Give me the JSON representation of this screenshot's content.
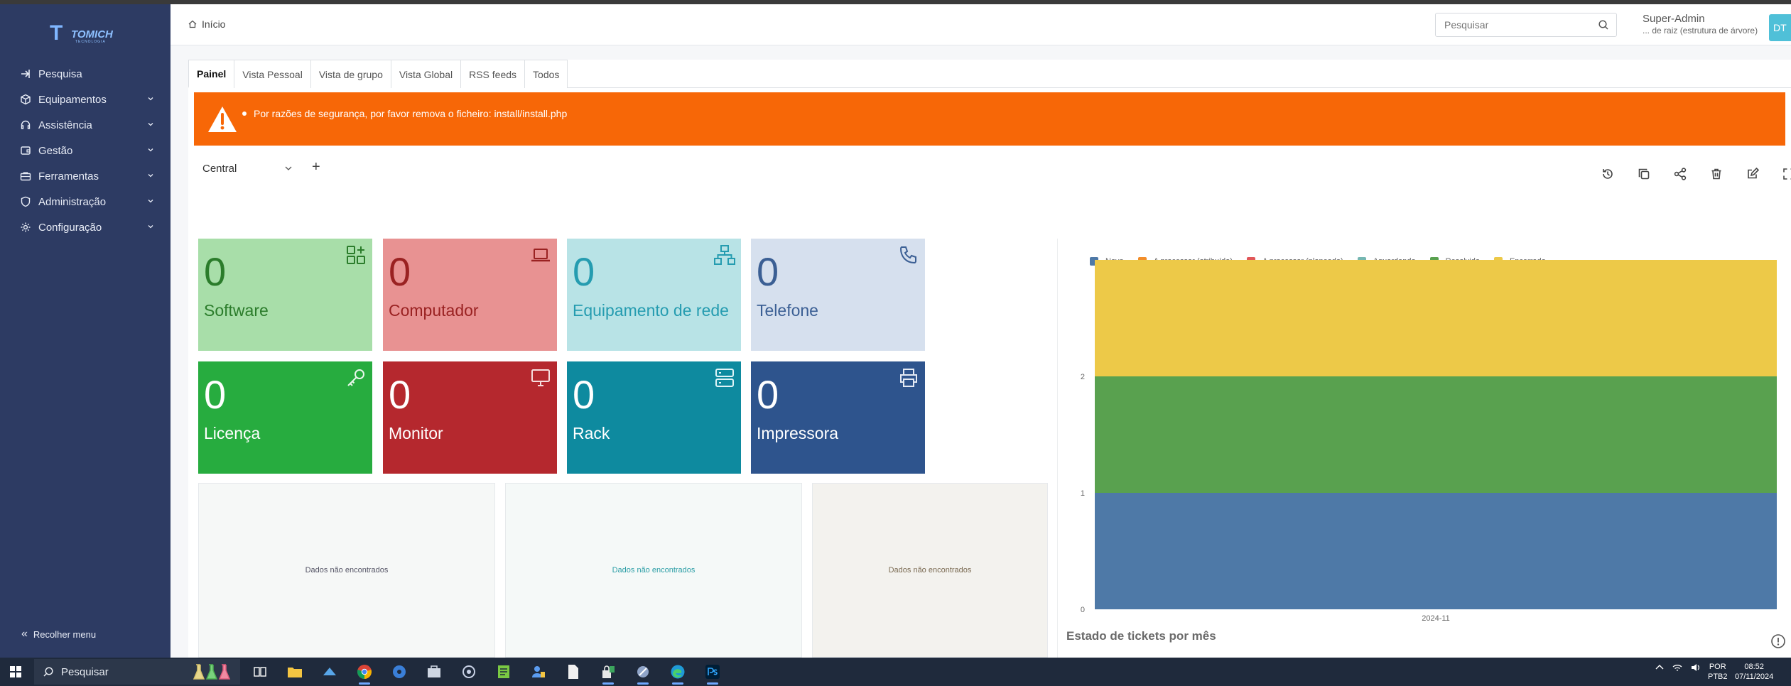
{
  "sidebar": {
    "logo": {
      "mark": "T",
      "brand": "TOMICH",
      "sub": "TECNOLOGIA"
    },
    "items": [
      {
        "label": "Pesquisa",
        "icon": "search-arrow-icon",
        "has_children": false
      },
      {
        "label": "Equipamentos",
        "icon": "cube-icon",
        "has_children": true
      },
      {
        "label": "Assistência",
        "icon": "headset-icon",
        "has_children": true
      },
      {
        "label": "Gestão",
        "icon": "wallet-icon",
        "has_children": true
      },
      {
        "label": "Ferramentas",
        "icon": "briefcase-icon",
        "has_children": true
      },
      {
        "label": "Administração",
        "icon": "shield-icon",
        "has_children": true
      },
      {
        "label": "Configuração",
        "icon": "gear-icon",
        "has_children": true
      }
    ],
    "collapse_label": "Recolher menu"
  },
  "header": {
    "breadcrumb": "Início",
    "search_placeholder": "Pesquisar",
    "user_name": "Super-Admin",
    "user_entity": "... de raiz (estrutura de árvore)",
    "avatar_initials": "DT"
  },
  "tabs": [
    "Painel",
    "Vista Pessoal",
    "Vista de grupo",
    "Vista Global",
    "RSS feeds",
    "Todos"
  ],
  "alert": {
    "message": "Por razões de segurança, por favor remova o ficheiro: install/install.php"
  },
  "dashboard": {
    "selected": "Central",
    "add_symbol": "+"
  },
  "cards": {
    "software": {
      "value": "0",
      "label": "Software"
    },
    "computer": {
      "value": "0",
      "label": "Computador"
    },
    "network": {
      "value": "0",
      "label": "Equipamento de rede"
    },
    "phone": {
      "value": "0",
      "label": "Telefone"
    },
    "license": {
      "value": "0",
      "label": "Licença"
    },
    "monitor": {
      "value": "0",
      "label": "Monitor"
    },
    "rack": {
      "value": "0",
      "label": "Rack"
    },
    "printer": {
      "value": "0",
      "label": "Impressora"
    }
  },
  "empty_widgets": [
    "Dados não encontrados",
    "Dados não encontrados",
    "Dados não encontrados"
  ],
  "chart_title": "Estado de tickets por mês",
  "chart_data": {
    "type": "bar",
    "stacked": true,
    "categories": [
      "2024-11"
    ],
    "series": [
      {
        "name": "Novo",
        "color": "#4e79a7",
        "values": [
          1
        ]
      },
      {
        "name": "A processar (atribuído)",
        "color": "#f28e2b",
        "values": [
          0
        ]
      },
      {
        "name": "A processar (planeado)",
        "color": "#e15759",
        "values": [
          0
        ]
      },
      {
        "name": "Aguardando",
        "color": "#76b7b2",
        "values": [
          0
        ]
      },
      {
        "name": "Resolvido",
        "color": "#59a14f",
        "values": [
          1
        ]
      },
      {
        "name": "Encerrado",
        "color": "#edc948",
        "values": [
          1
        ]
      }
    ],
    "ylim": [
      0,
      3
    ],
    "yticks": [
      "0",
      "1",
      "2"
    ],
    "legend": "top-left"
  },
  "taskbar": {
    "search_label": "Pesquisar",
    "lang": "POR",
    "layout": "PTB2",
    "time": "08:52",
    "date": "07/11/2024"
  }
}
